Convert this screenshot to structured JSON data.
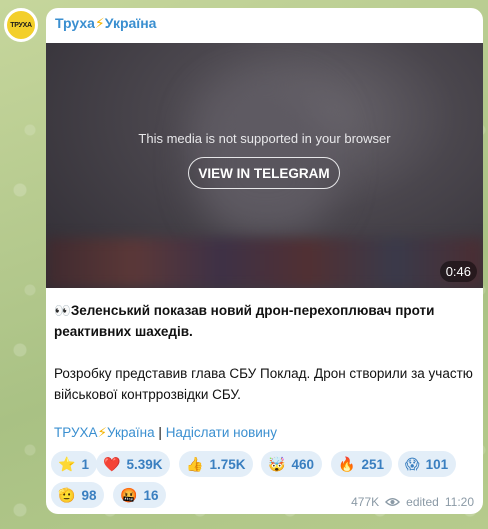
{
  "channel": {
    "name_part1": "Труха",
    "bolt": "⚡",
    "name_part2": "Україна",
    "avatar_text": "ТРУХА"
  },
  "media": {
    "unsupported_text": "This media is not supported in your browser",
    "view_button": "VIEW IN TELEGRAM",
    "duration": "0:46"
  },
  "message": {
    "headline_emoji": "👀",
    "headline": "Зеленський показав новий дрон-перехоплювач проти реактивних шахедів.",
    "body": "Розробку представив глава СБУ Поклад. Дрон створили за участю військової контррозвідки СБУ."
  },
  "links": {
    "channel_part1": "ТРУХА",
    "bolt": "⚡",
    "channel_part2": "Україна",
    "separator": "|",
    "submit_news": "Надіслати новину"
  },
  "reactions": [
    {
      "emoji": "⭐",
      "count": "1"
    },
    {
      "emoji": "❤️",
      "count": "5.39K"
    },
    {
      "emoji": "👍",
      "count": "1.75K"
    },
    {
      "emoji": "🤯",
      "count": "460"
    },
    {
      "emoji": "🔥",
      "count": "251"
    },
    {
      "emoji": "😱",
      "count": "101"
    },
    {
      "emoji": "🫡",
      "count": "98"
    },
    {
      "emoji": "🤬",
      "count": "16"
    }
  ],
  "meta": {
    "views": "477K",
    "edited": "edited",
    "time": "11:20",
    "views_icon": "eye-icon"
  },
  "colors": {
    "accent": "#3a8fd0",
    "reaction_bg": "#e3eef8",
    "background": "#b8cc8f"
  }
}
